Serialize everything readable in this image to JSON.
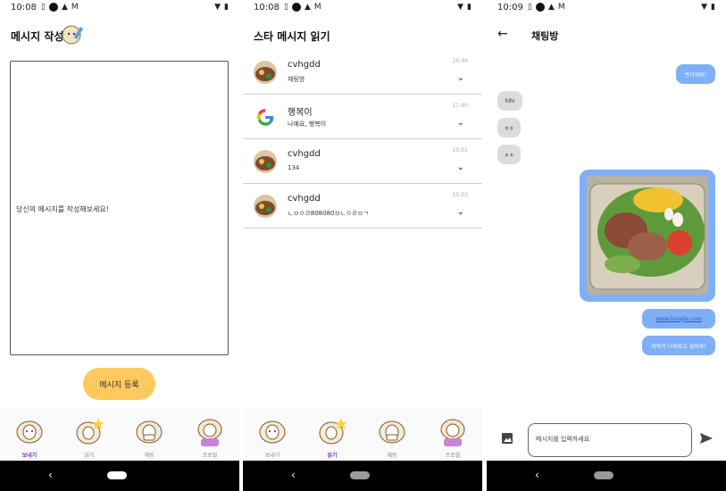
{
  "screens": [
    {
      "status": {
        "time": "10:08"
      },
      "title": "메시지 작성",
      "placeholder": "당신의 메시지를 작성해보세요!",
      "submit_label": "메시지 등록",
      "nav": [
        {
          "label": "보내기",
          "active": true
        },
        {
          "label": "읽기",
          "active": false
        },
        {
          "label": "채팅",
          "active": false
        },
        {
          "label": "프로필",
          "active": false
        }
      ]
    },
    {
      "status": {
        "time": "10:08"
      },
      "title": "스타 메시지 읽기",
      "rows": [
        {
          "name": "cvhgdd",
          "message": "채팅방",
          "time": "20:49",
          "avatar": "food"
        },
        {
          "name": "행복이",
          "message": "나예요, 행복이",
          "time": "17:40",
          "avatar": "google"
        },
        {
          "name": "cvhgdd",
          "message": "134",
          "time": "15:55",
          "avatar": "food"
        },
        {
          "name": "cvhgdd",
          "message": "ㄴㅁㅇㄹ808080ㅁㄴㅇㄹㅁㄱ",
          "time": "15:53",
          "avatar": "food"
        }
      ],
      "nav": [
        {
          "label": "보내기",
          "active": false
        },
        {
          "label": "읽기",
          "active": true
        },
        {
          "label": "채팅",
          "active": false
        },
        {
          "label": "프로필",
          "active": false
        }
      ]
    },
    {
      "status": {
        "time": "10:09"
      },
      "title": "채팅방",
      "messages": {
        "out1": "반가워요!",
        "in1": "hihi",
        "in2": "ㅎㅎ",
        "in3": "ㅈㅈ",
        "link": "www.Google.com",
        "out2": "이야기 나눠보고 싶어요!"
      },
      "input_placeholder": "메시지를 입력하세요"
    }
  ],
  "icons": {
    "back": "back-arrow-icon",
    "chevron": "chevron-down-icon",
    "image": "image-icon",
    "send": "send-icon"
  },
  "colors": {
    "accent_button": "#ffc95f",
    "nav_active": "#7c39c9",
    "bubble_out": "#7fb0f7",
    "bubble_in": "#dcdcdc"
  }
}
